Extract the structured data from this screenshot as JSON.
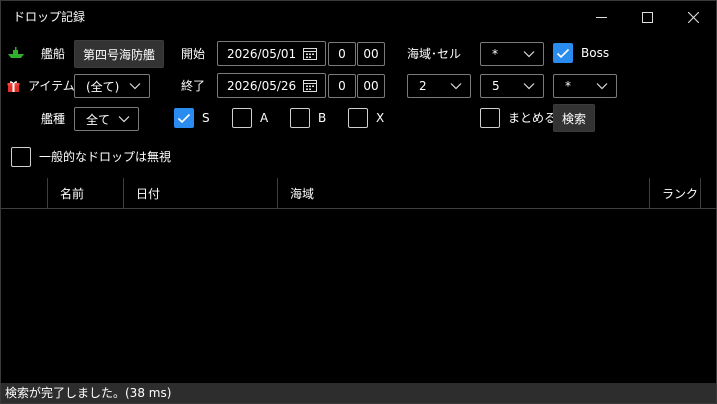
{
  "window": {
    "title": "ドロップ記録",
    "min_icon": "minimize-icon",
    "max_icon": "maximize-icon",
    "close_icon": "close-icon"
  },
  "filters": {
    "ship": {
      "label": "艦船",
      "value": "第四号海防艦",
      "icon": "ship-icon"
    },
    "item": {
      "label": "アイテム",
      "value": "(全て)",
      "icon": "gift-icon"
    },
    "ship_type": {
      "label": "艦種",
      "value": "全て"
    },
    "start": {
      "label": "開始",
      "date": "2026/05/01",
      "hour": "0",
      "minute": "00"
    },
    "end": {
      "label": "終了",
      "date": "2026/05/26",
      "hour": "0",
      "minute": "00"
    },
    "map": {
      "label": "海域･セル",
      "area": "*",
      "world": "2",
      "sub": "5",
      "cell": "*"
    },
    "boss": {
      "label": "Boss",
      "checked": true
    },
    "ranks": [
      {
        "label": "S",
        "checked": true
      },
      {
        "label": "A",
        "checked": false
      },
      {
        "label": "B",
        "checked": false
      },
      {
        "label": "X",
        "checked": false
      }
    ],
    "merge": {
      "label": "まとめる",
      "checked": false
    },
    "search_label": "検索",
    "ignore_common": {
      "label": "一般的なドロップは無視",
      "checked": false
    }
  },
  "table": {
    "columns": [
      "名前",
      "日付",
      "海域",
      "ランク"
    ],
    "rows": []
  },
  "status": {
    "text": "検索が完了しました。(38 ms)"
  },
  "colors": {
    "background": "#000000",
    "accent": "#2b8cf0",
    "ship_icon": "#2fae2f",
    "gift_icon": "#e0302a",
    "statusbar": "#2d2d2d"
  }
}
